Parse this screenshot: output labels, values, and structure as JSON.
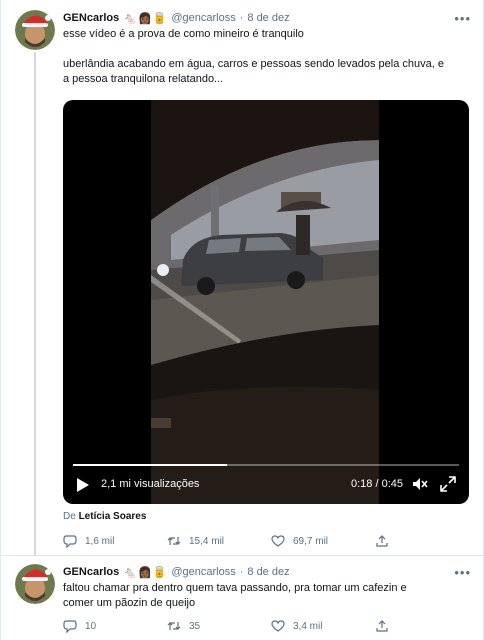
{
  "tweets": [
    {
      "author": {
        "name": "GENcarlos",
        "emoji": "🐁👩🏾🥫",
        "handle": "@gencarloss",
        "date": "8 de dez"
      },
      "more_label": "•••",
      "text_line1": "esse vídeo é a prova de como mineiro é tranquilo",
      "text_para2_line1": "uberlândia acabando em água, carros e pessoas sendo levados pela chuva, e",
      "text_para2_line2": "a pessoa tranquilona relatando...",
      "video": {
        "views": "2,1 mi visualizações",
        "time": "0:18 / 0:45",
        "progress": 0.4
      },
      "credit": {
        "prefix": "De",
        "name": "Letícia Soares"
      },
      "actions": {
        "reply": "1,6 mil",
        "retweet": "15,4 mil",
        "like": "69,7 mil"
      }
    },
    {
      "author": {
        "name": "GENcarlos",
        "emoji": "🐁👩🏾🥫",
        "handle": "@gencarloss",
        "date": "8 de dez"
      },
      "more_label": "•••",
      "text_line1": "faltou chamar pra dentro quem tava passando, pra tomar um cafezin e",
      "text_line2": "comer um pãozin de queijo",
      "actions": {
        "reply": "10",
        "retweet": "35",
        "like": "3,4 mil"
      }
    }
  ],
  "colors": {
    "secondary_text": "#5b7083",
    "divider": "#e1e8ed",
    "primary_text": "#0f1419"
  },
  "icons": [
    "reply-icon",
    "retweet-icon",
    "like-icon",
    "share-icon",
    "play-icon",
    "mute-icon",
    "fullscreen-icon",
    "more-icon"
  ]
}
